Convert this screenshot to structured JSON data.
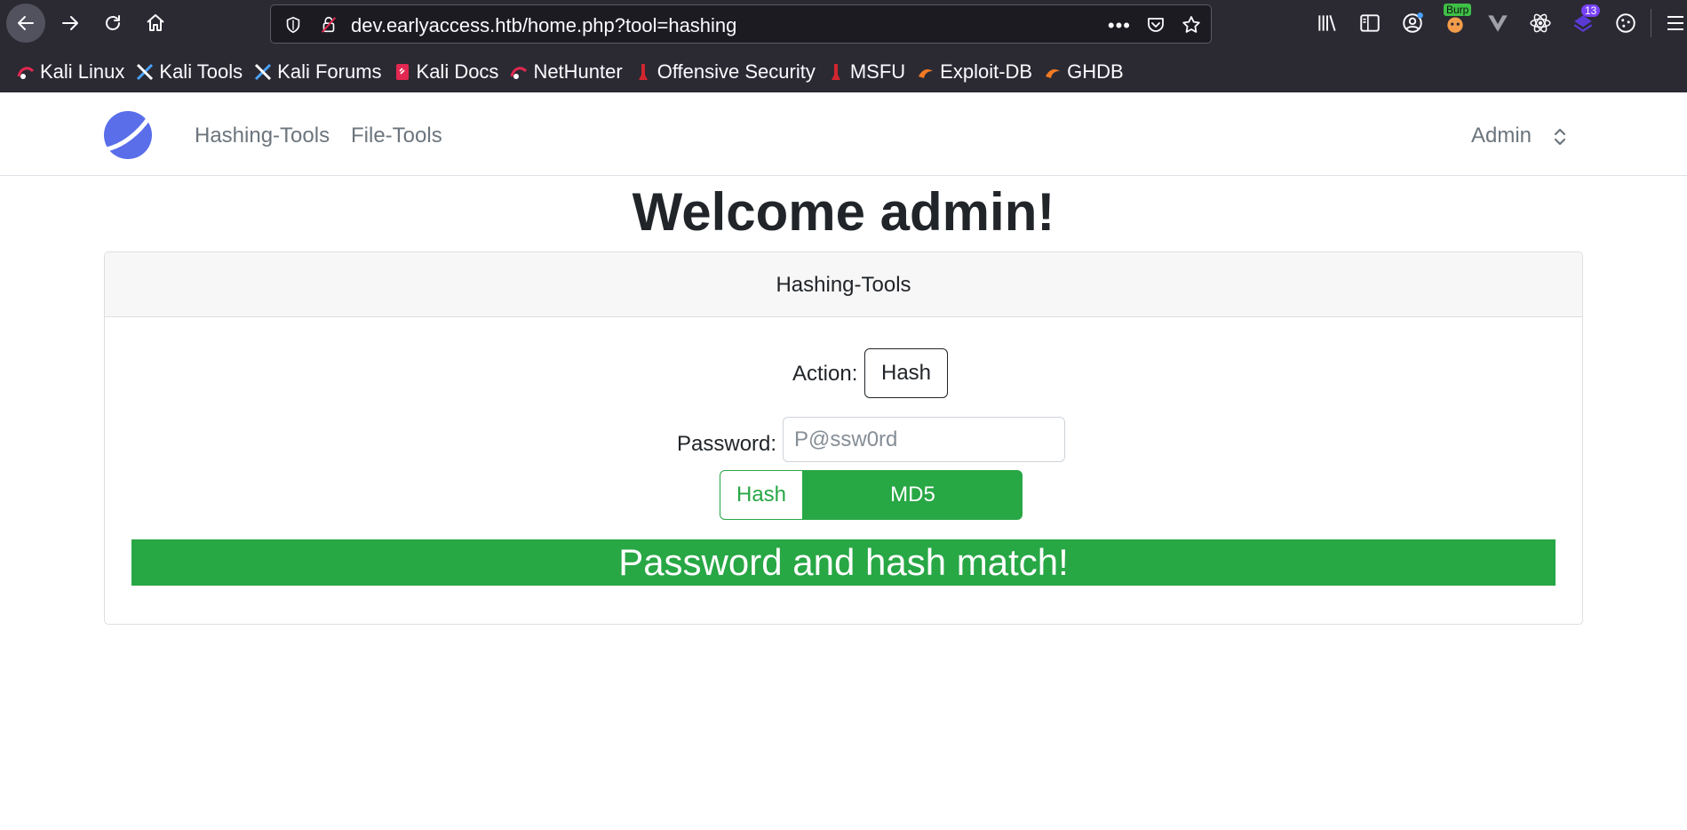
{
  "browser": {
    "url_host": "dev.earlyaccess.htb",
    "url_path": "/home.php?tool=hashing",
    "more_label": "•••",
    "burp_badge": "Burp",
    "ext_count": "13",
    "bookmarks": [
      {
        "label": "Kali Linux",
        "icon": "kali-dragon-icon"
      },
      {
        "label": "Kali Tools",
        "icon": "kali-tools-icon"
      },
      {
        "label": "Kali Forums",
        "icon": "kali-forums-icon"
      },
      {
        "label": "Kali Docs",
        "icon": "kali-docs-icon"
      },
      {
        "label": "NetHunter",
        "icon": "kali-dragon-icon"
      },
      {
        "label": "Offensive Security",
        "icon": "offsec-icon"
      },
      {
        "label": "MSFU",
        "icon": "offsec-icon"
      },
      {
        "label": "Exploit-DB",
        "icon": "exploitdb-icon"
      },
      {
        "label": "GHDB",
        "icon": "exploitdb-icon"
      }
    ]
  },
  "nav": {
    "hashing": "Hashing-Tools",
    "file": "File-Tools",
    "admin": "Admin"
  },
  "welcome": "Welcome admin!",
  "card": {
    "header": "Hashing-Tools",
    "action_label": "Action:",
    "action_value": "Hash",
    "password_label": "Password:",
    "password_placeholder": "P@ssw0rd",
    "hash_button": "Hash",
    "algorithm": "MD5",
    "result": "Password and hash match!"
  },
  "colors": {
    "success": "#28a745",
    "chrome_bg": "#2b2a33",
    "logo": "#5a6eea"
  }
}
